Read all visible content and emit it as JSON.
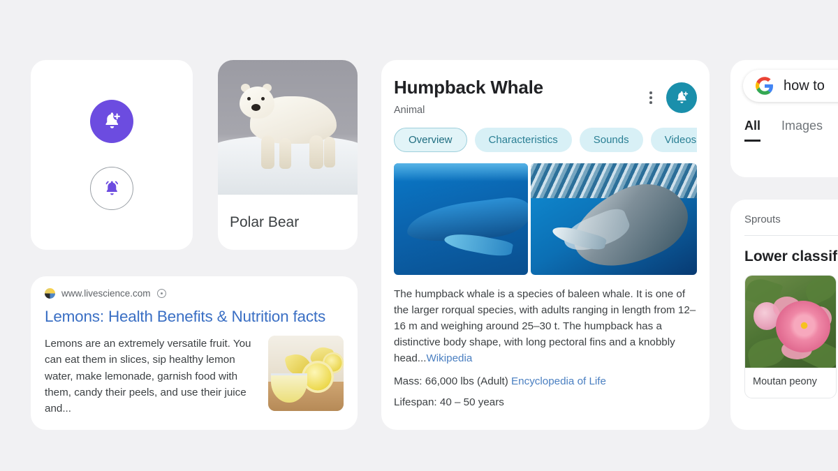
{
  "theme": {
    "background": "#f1f1f3",
    "card_bg": "#ffffff",
    "purple_accent": "#6c4ce0",
    "teal_accent": "#1a8fab",
    "chip_bg": "#d8f0f6",
    "chip_active_bg": "#e2f4f8",
    "chip_text": "#2a7f94",
    "link_blue": "#4a7fc1",
    "title_blue": "#3a6fc4",
    "text_primary": "#202124",
    "text_secondary": "#5f6368"
  },
  "notification_card": {
    "add_bell_icon": "bell-plus-icon",
    "active_bell_icon": "bell-ringing-icon"
  },
  "polar_bear_card": {
    "photo_alt": "polar-bear-photo",
    "caption": "Polar Bear"
  },
  "whale_card": {
    "title": "Humpback Whale",
    "subtitle": "Animal",
    "menu_icon": "more-vertical-icon",
    "notify_icon": "bell-plus-icon",
    "chips": [
      {
        "label": "Overview",
        "active": true
      },
      {
        "label": "Characteristics",
        "active": false
      },
      {
        "label": "Sounds",
        "active": false
      },
      {
        "label": "Videos",
        "active": false
      }
    ],
    "photos": [
      {
        "alt": "humpback-whale-underwater-blue"
      },
      {
        "alt": "humpback-whale-surfacing"
      }
    ],
    "description": "The humpback whale is a species of baleen whale. It is one of the larger rorqual species, with adults ranging in length from 12–16 m and weighing around 25–30 t. The humpback has a distinctive body shape, with long pectoral fins and a knobbly head...",
    "description_source": "Wikipedia",
    "facts": [
      {
        "label": "Mass:",
        "value": "66,000 lbs (Adult)",
        "source": "Encyclopedia of Life"
      },
      {
        "label": "Lifespan:",
        "value": "40 – 50 years",
        "source": ""
      }
    ]
  },
  "lemon_card": {
    "favicon": "livescience-favicon",
    "url": "www.livescience.com",
    "more_icon": "about-this-result-icon",
    "title": "Lemons: Health Benefits & Nutrition facts",
    "snippet": "Lemons are an extremely versatile fruit. You can eat them in slices, sip healthy lemon water, make lemonade, garnish food with them, candy their peels, and use their juice and...",
    "thumbnail_alt": "sliced-lemons-photo"
  },
  "google_card": {
    "logo_icon": "google-g-icon",
    "query": "how to",
    "tabs": [
      {
        "label": "All",
        "active": true
      },
      {
        "label": "Images",
        "active": false
      }
    ]
  },
  "sprouts_card": {
    "section_label": "Sprouts",
    "heading": "Lower classif",
    "tile": {
      "photo_alt": "moutan-peony-photo",
      "caption": "Moutan peony"
    }
  }
}
